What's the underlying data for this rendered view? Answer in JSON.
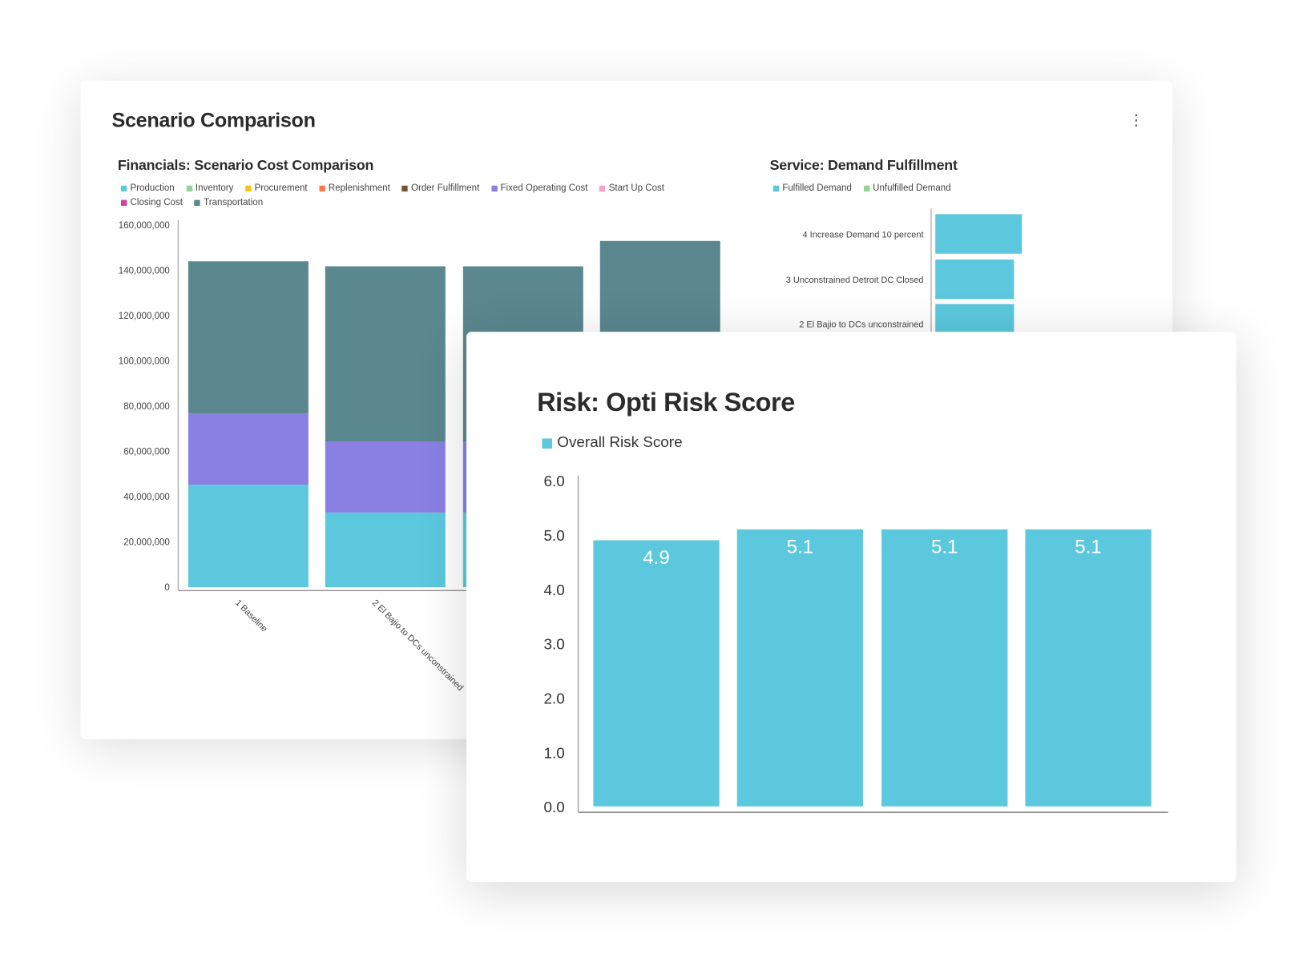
{
  "page": {
    "title": "Scenario Comparison",
    "menu_icon": "kebab-vertical-icon"
  },
  "financials": {
    "title": "Financials: Scenario Cost Comparison",
    "legend": [
      {
        "label": "Production",
        "color": "#5bc8de"
      },
      {
        "label": "Inventory",
        "color": "#8fd694"
      },
      {
        "label": "Procurement",
        "color": "#f5c518"
      },
      {
        "label": "Replenishment",
        "color": "#f47a4a"
      },
      {
        "label": "Order Fulfillment",
        "color": "#7b5230"
      },
      {
        "label": "Fixed Operating Cost",
        "color": "#8a7fe3"
      },
      {
        "label": "Start Up Cost",
        "color": "#f7a1c4"
      },
      {
        "label": "Closing Cost",
        "color": "#d63fa0"
      },
      {
        "label": "Transportation",
        "color": "#5a888e"
      }
    ]
  },
  "service": {
    "title": "Service: Demand Fulfillment",
    "legend": [
      {
        "label": "Fulfilled Demand",
        "color": "#5bc8de"
      },
      {
        "label": "Unfulfilled Demand",
        "color": "#8fd694"
      }
    ]
  },
  "risk": {
    "title": "Risk: Opti Risk Score",
    "legend": [
      {
        "label": "Overall Risk Score",
        "color": "#5bc8de"
      }
    ]
  },
  "chart_data": [
    {
      "type": "bar",
      "stacked": true,
      "title": "Financials: Scenario Cost Comparison",
      "categories": [
        "1 Baseline",
        "2 El Bajio to DCs unconstrained",
        "3 Unconstrained Detroit DC Closed",
        "4 Increase Demand 10 percent"
      ],
      "series": [
        {
          "name": "Production",
          "color": "#5bc8de",
          "values": [
            45300000,
            33000000,
            33000000,
            36000000
          ]
        },
        {
          "name": "Fixed Operating Cost",
          "color": "#8a7fe3",
          "values": [
            31500000,
            31200000,
            31200000,
            31200000
          ]
        },
        {
          "name": "Transportation",
          "color": "#5a888e",
          "values": [
            67200000,
            77600000,
            77600000,
            85800000
          ]
        }
      ],
      "ylim": [
        0,
        160000000
      ],
      "yticks": [
        "0",
        "20,000,000",
        "40,000,000",
        "60,000,000",
        "80,000,000",
        "100,000,000",
        "120,000,000",
        "140,000,000",
        "160,000,000"
      ],
      "legend": "top"
    },
    {
      "type": "bar",
      "orientation": "horizontal",
      "title": "Service: Demand Fulfillment",
      "categories": [
        "4 Increase Demand 10 percent",
        "3 Unconstrained Detroit DC Closed",
        "2 El Bajio to DCs unconstrained"
      ],
      "series": [
        {
          "name": "Fulfilled Demand",
          "color": "#5bc8de",
          "values": [
            110,
            100,
            100
          ]
        }
      ],
      "legend": "top"
    },
    {
      "type": "bar",
      "title": "Risk: Opti Risk Score",
      "series": [
        {
          "name": "Overall Risk Score",
          "color": "#5bc8de",
          "values": [
            4.9,
            5.1,
            5.1,
            5.1
          ]
        }
      ],
      "data_labels": [
        "4.9",
        "5.1",
        "5.1",
        "5.1"
      ],
      "ylim": [
        0,
        6
      ],
      "yticks": [
        "0.0",
        "1.0",
        "2.0",
        "3.0",
        "4.0",
        "5.0",
        "6.0"
      ],
      "legend": "top-left"
    }
  ]
}
